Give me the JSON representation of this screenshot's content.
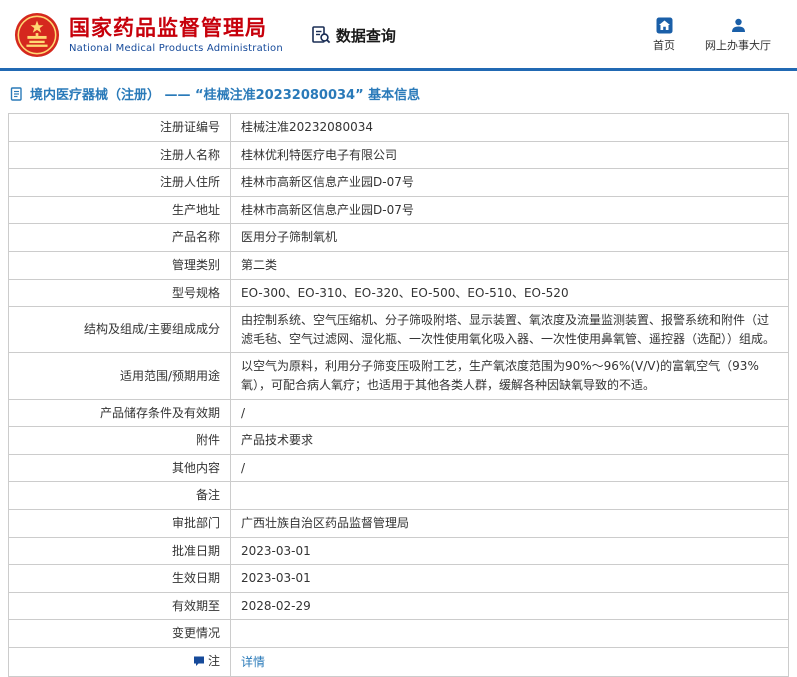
{
  "header": {
    "org_name_cn": "国家药品监督管理局",
    "org_name_en": "National Medical Products Administration",
    "section_title": "数据查询",
    "nav": [
      {
        "label": "首页"
      },
      {
        "label": "网上办事大厅"
      }
    ]
  },
  "colors": {
    "brand_red": "#c7000b",
    "brand_blue": "#164a9a",
    "link_blue": "#2a7ab9",
    "divider_blue": "#2169b3",
    "table_border": "#cccccc"
  },
  "breadcrumb": {
    "text": "境内医疗器械（注册） —— “桂械注准20232080034” 基本信息"
  },
  "table": {
    "rows": [
      {
        "label": "注册证编号",
        "value": "桂械注准20232080034"
      },
      {
        "label": "注册人名称",
        "value": "桂林优利特医疗电子有限公司"
      },
      {
        "label": "注册人住所",
        "value": "桂林市高新区信息产业园D-07号"
      },
      {
        "label": "生产地址",
        "value": "桂林市高新区信息产业园D-07号"
      },
      {
        "label": "产品名称",
        "value": "医用分子筛制氧机"
      },
      {
        "label": "管理类别",
        "value": "第二类"
      },
      {
        "label": "型号规格",
        "value": "EO-300、EO-310、EO-320、EO-500、EO-510、EO-520"
      },
      {
        "label": "结构及组成/主要组成成分",
        "value": "由控制系统、空气压缩机、分子筛吸附塔、显示装置、氧浓度及流量监测装置、报警系统和附件（过滤毛毡、空气过滤网、湿化瓶、一次性使用氧化吸入器、一次性使用鼻氧管、遥控器（选配））组成。"
      },
      {
        "label": "适用范围/预期用途",
        "value": "以空气为原料，利用分子筛变压吸附工艺，生产氧浓度范围为90%～96%(V/V)的富氧空气（93%氧），可配合病人氧疗；也适用于其他各类人群，缓解各种因缺氧导致的不适。"
      },
      {
        "label": "产品储存条件及有效期",
        "value": "/"
      },
      {
        "label": "附件",
        "value": "产品技术要求"
      },
      {
        "label": "其他内容",
        "value": "/"
      },
      {
        "label": "备注",
        "value": ""
      },
      {
        "label": "审批部门",
        "value": "广西壮族自治区药品监督管理局"
      },
      {
        "label": "批准日期",
        "value": "2023-03-01"
      },
      {
        "label": "生效日期",
        "value": "2023-03-01"
      },
      {
        "label": "有效期至",
        "value": "2028-02-29"
      },
      {
        "label": "变更情况",
        "value": ""
      },
      {
        "label": "注",
        "value": "详情",
        "is_link": true,
        "has_icon": true
      }
    ]
  }
}
